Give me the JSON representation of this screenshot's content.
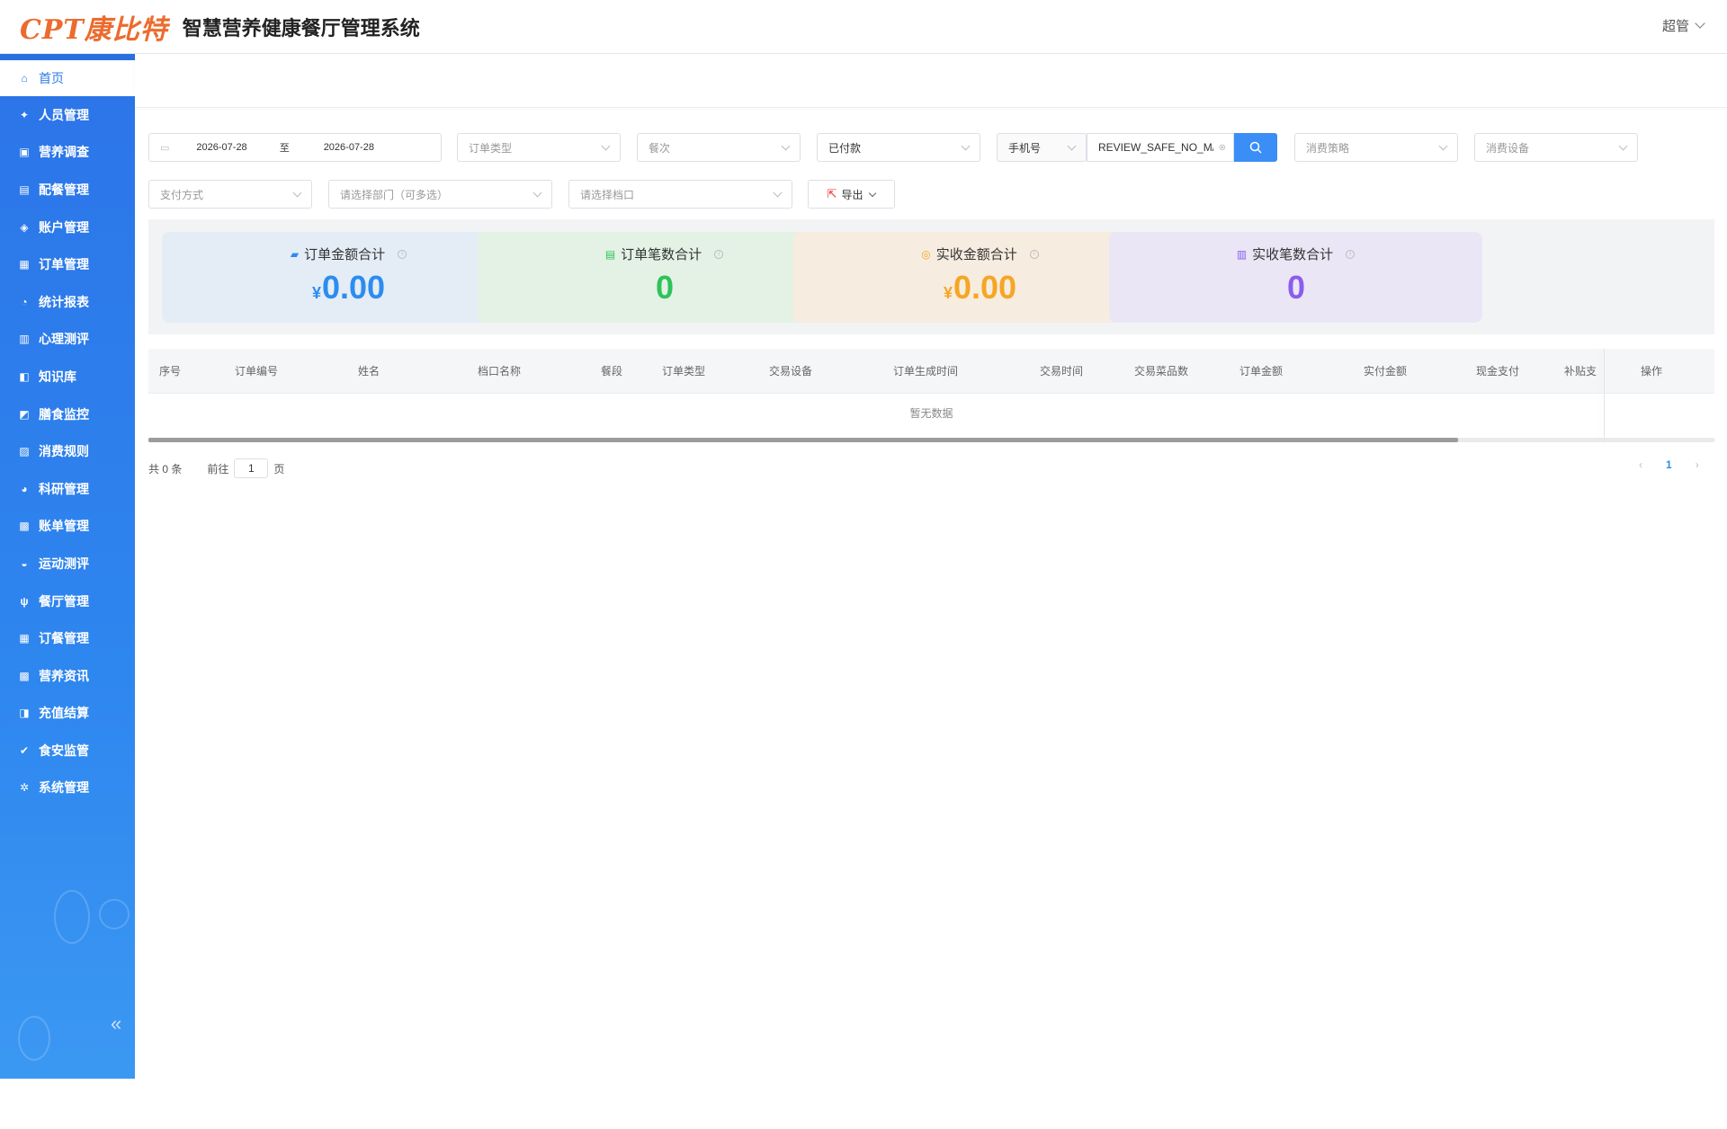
{
  "header": {
    "logo": "CPT康比特",
    "title": "智慧营养健康餐厅管理系统",
    "user": "超管"
  },
  "sidebar": {
    "items": [
      {
        "label": "首页",
        "icon": "home-icon",
        "glyph": "⌂"
      },
      {
        "label": "人员管理",
        "icon": "people-icon",
        "glyph": "✦"
      },
      {
        "label": "营养调查",
        "icon": "survey-icon",
        "glyph": "▣"
      },
      {
        "label": "配餐管理",
        "icon": "meal-plan-icon",
        "glyph": "▤"
      },
      {
        "label": "账户管理",
        "icon": "account-icon",
        "glyph": "◈"
      },
      {
        "label": "订单管理",
        "icon": "order-icon",
        "glyph": "▦"
      },
      {
        "label": "统计报表",
        "icon": "pie-chart-icon",
        "glyph": "◔"
      },
      {
        "label": "心理测评",
        "icon": "document-icon",
        "glyph": "▥"
      },
      {
        "label": "知识库",
        "icon": "knowledge-icon",
        "glyph": "◧"
      },
      {
        "label": "膳食监控",
        "icon": "monitor-icon",
        "glyph": "◩"
      },
      {
        "label": "消费规则",
        "icon": "rules-icon",
        "glyph": "▨"
      },
      {
        "label": "科研管理",
        "icon": "research-icon",
        "glyph": "◕"
      },
      {
        "label": "账单管理",
        "icon": "bill-icon",
        "glyph": "▩"
      },
      {
        "label": "运动测评",
        "icon": "sport-icon",
        "glyph": "◒"
      },
      {
        "label": "餐厅管理",
        "icon": "utensils-icon",
        "glyph": "ψ"
      },
      {
        "label": "订餐管理",
        "icon": "booking-icon",
        "glyph": "▦"
      },
      {
        "label": "营养资讯",
        "icon": "news-icon",
        "glyph": "▩"
      },
      {
        "label": "充值结算",
        "icon": "wallet-icon",
        "glyph": "◨"
      },
      {
        "label": "食安监管",
        "icon": "shield-icon",
        "glyph": "✔"
      },
      {
        "label": "系统管理",
        "icon": "gear-icon",
        "glyph": "✲"
      }
    ],
    "collapse_glyph": "«"
  },
  "filters": {
    "date_start": "2026-07-28",
    "date_sep": "至",
    "date_end": "2026-07-28",
    "order_type_placeholder": "订单类型",
    "meal_placeholder": "餐次",
    "pay_status": "已付款",
    "phone_type": "手机号",
    "search_value": "REVIEW_SAFE_NO_M/",
    "strategy_placeholder": "消费策略",
    "device_placeholder": "消费设备",
    "pay_method_placeholder": "支付方式",
    "dept_placeholder": "请选择部门（可多选）",
    "stall_placeholder": "请选择档口",
    "export_label": "导出"
  },
  "cards": [
    {
      "title": "订单金额合计",
      "currency": "¥",
      "value": "0.00",
      "color": "#2d8cf0",
      "bg": "#e4edf6",
      "icon": "wallet-icon"
    },
    {
      "title": "订单笔数合计",
      "currency": "",
      "value": "0",
      "color": "#2fc25b",
      "bg": "#e3f2e4",
      "icon": "document-icon"
    },
    {
      "title": "实收金额合计",
      "currency": "¥",
      "value": "0.00",
      "color": "#f5a623",
      "bg": "#f7ece0",
      "icon": "coins-icon"
    },
    {
      "title": "实收笔数合计",
      "currency": "",
      "value": "0",
      "color": "#8a5cf0",
      "bg": "#ebe6f5",
      "icon": "list-icon"
    }
  ],
  "table": {
    "columns": [
      "序号",
      "订单编号",
      "姓名",
      "档口名称",
      "餐段",
      "订单类型",
      "交易设备",
      "订单生成时间",
      "交易时间",
      "交易菜品数",
      "订单金额",
      "实付金额",
      "现金支付",
      "补贴支",
      "操作"
    ],
    "empty_text": "暂无数据"
  },
  "pagination": {
    "total": "共 0 条",
    "goto_label": "前往",
    "page_value": "1",
    "page_suffix": "页",
    "current_page": "1"
  }
}
